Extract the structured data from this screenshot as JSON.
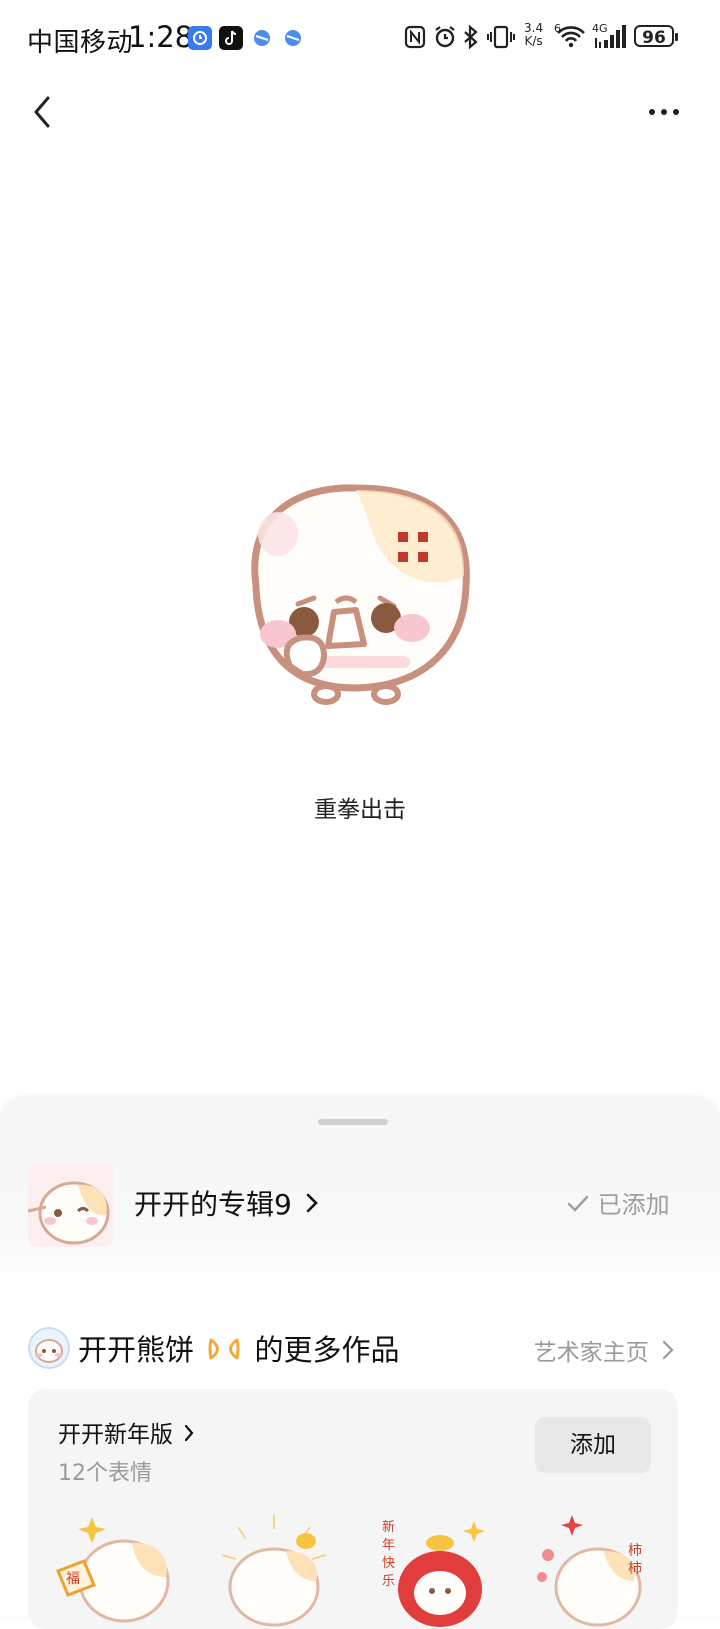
{
  "status_bar": {
    "carrier": "中国移动",
    "time": "1:28",
    "net_speed_value": "3.4",
    "net_speed_unit": "K/s",
    "signal_label": "4G",
    "wifi_label": "6",
    "battery": "96"
  },
  "nav": {
    "back_icon": "chevron-left-icon",
    "more_icon": "more-horizontal-icon"
  },
  "sticker": {
    "caption": "重拳出击"
  },
  "album": {
    "title": "开开的专辑9",
    "chevron": "›",
    "status": "已添加"
  },
  "artist": {
    "name": "开开熊饼",
    "more_works": "的更多作品",
    "homepage_link": "艺术家主页",
    "chevron": "›"
  },
  "pack": {
    "title": "开开新年版",
    "chevron": "›",
    "count": "12个表情",
    "add_button": "添加"
  },
  "colors": {
    "accent_orange": "#f2a93b",
    "muted_text": "#9a9a9a",
    "sheet_bg": "#f6f6f6",
    "card_bg": "#f5f5f5"
  }
}
